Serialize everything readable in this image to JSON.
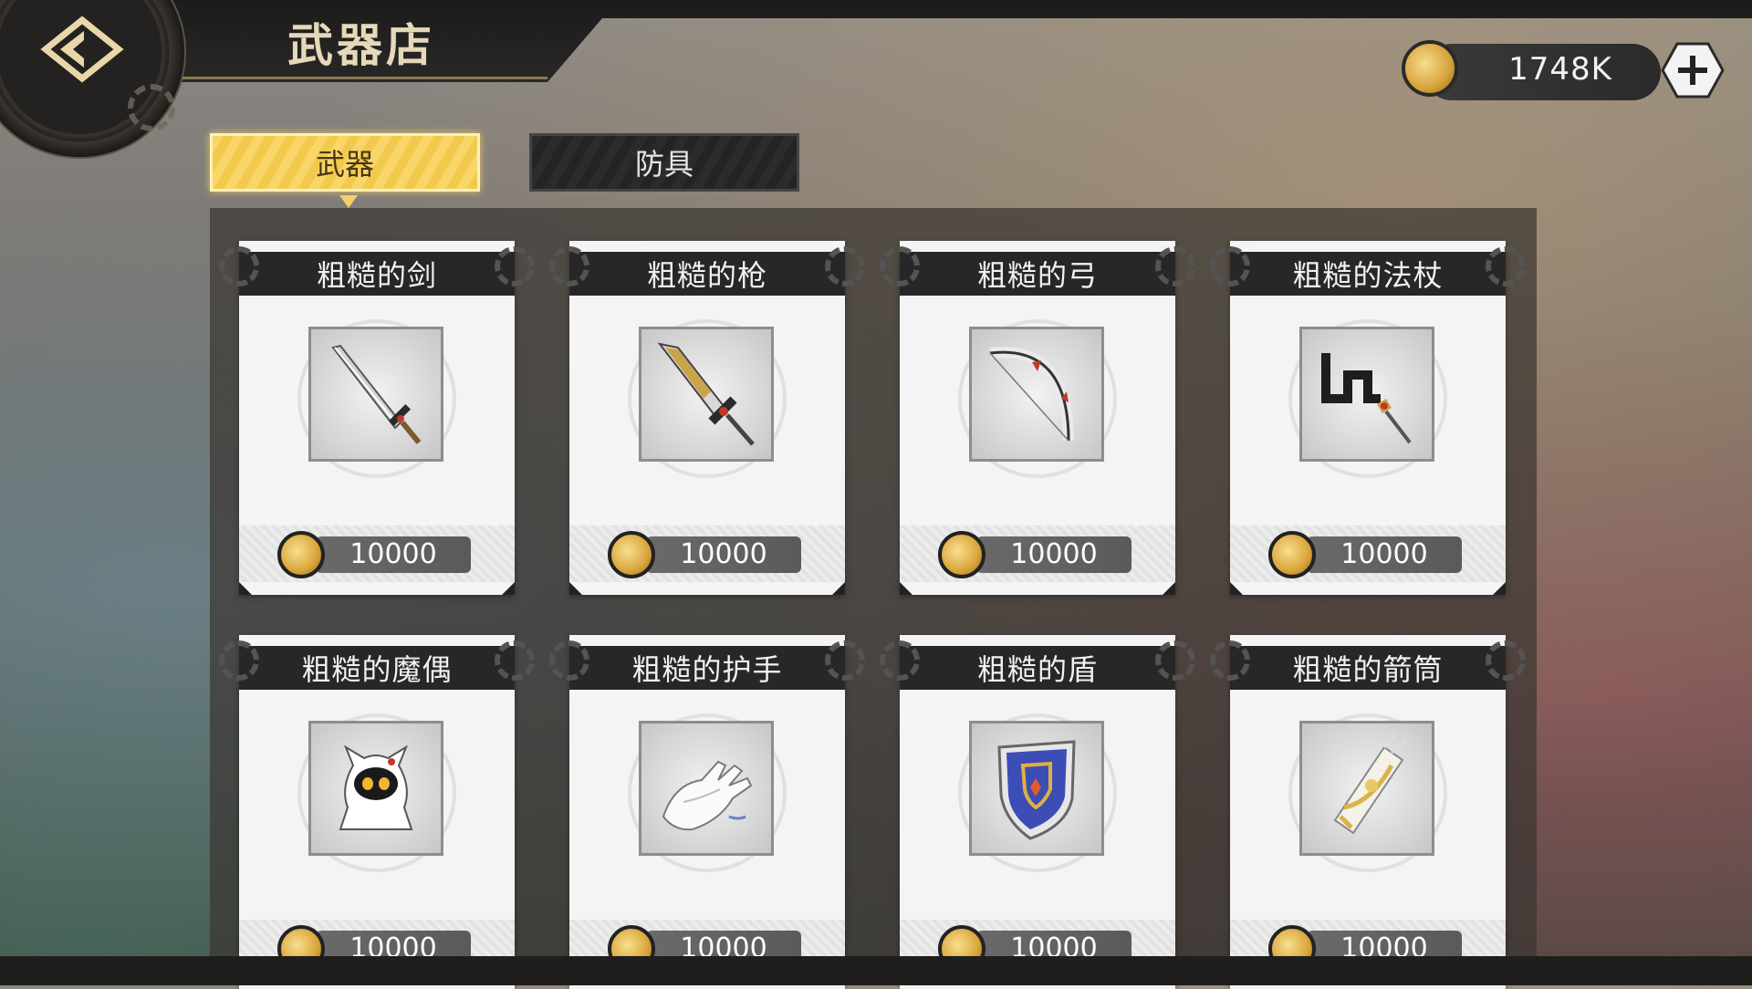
{
  "header": {
    "title": "武器店",
    "back_icon": "diamond-arrow-left-icon"
  },
  "currency": {
    "value": "1748K",
    "coin_icon": "gold-coin-icon",
    "add_icon": "plus-icon"
  },
  "tabs": [
    {
      "label": "武器",
      "active": true
    },
    {
      "label": "防具",
      "active": false
    }
  ],
  "colors": {
    "active_tab": "#f6cf5a",
    "card_header": "#272727",
    "coin": "#d9a53b"
  },
  "items": [
    {
      "name": "粗糙的剑",
      "price": "10000",
      "icon": "sword-icon"
    },
    {
      "name": "粗糙的枪",
      "price": "10000",
      "icon": "spear-icon"
    },
    {
      "name": "粗糙的弓",
      "price": "10000",
      "icon": "bow-icon"
    },
    {
      "name": "粗糙的法杖",
      "price": "10000",
      "icon": "staff-icon"
    },
    {
      "name": "粗糙的魔偶",
      "price": "10000",
      "icon": "hooded-doll-icon"
    },
    {
      "name": "粗糙的护手",
      "price": "10000",
      "icon": "gauntlet-icon"
    },
    {
      "name": "粗糙的盾",
      "price": "10000",
      "icon": "shield-icon"
    },
    {
      "name": "粗糙的箭筒",
      "price": "10000",
      "icon": "quiver-icon"
    }
  ]
}
